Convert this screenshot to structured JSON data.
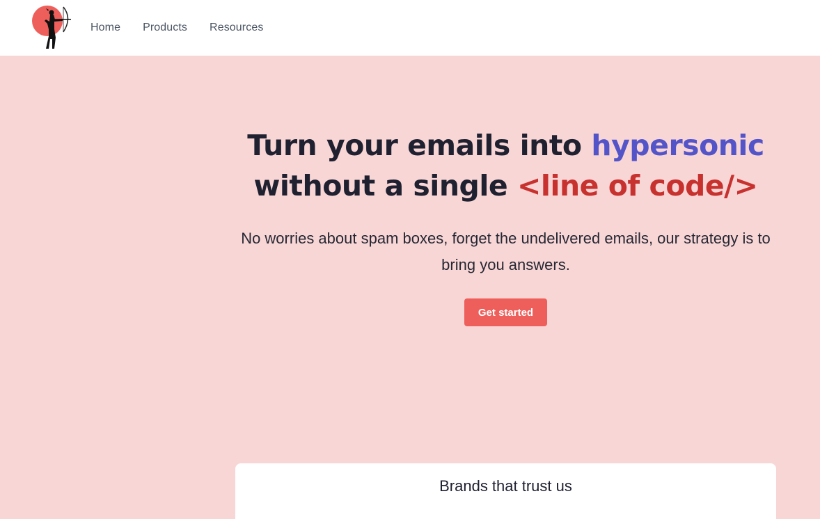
{
  "nav": {
    "logo_icon": "archer-logo-icon",
    "links": [
      {
        "label": "Home"
      },
      {
        "label": "Products"
      },
      {
        "label": "Resources"
      }
    ]
  },
  "hero": {
    "title_part1": "Turn your emails into ",
    "title_highlight1": "hypersonic",
    "title_part2": "without a single ",
    "title_highlight2": "<line of code/>",
    "subtitle": "No worries about spam boxes, forget the undelivered emails, our strategy is to bring you answers.",
    "cta_label": "Get started"
  },
  "brands": {
    "title": "Brands that trust us"
  },
  "colors": {
    "background": "#f9d6d6",
    "accent_blue": "#5454c9",
    "accent_red": "#c7322f",
    "button": "#ee5f5b"
  }
}
